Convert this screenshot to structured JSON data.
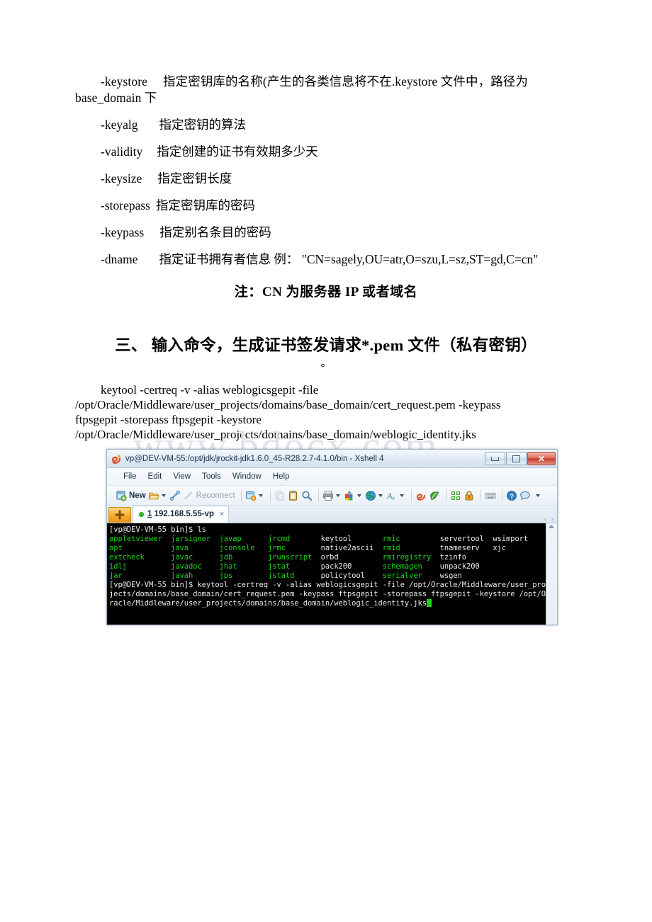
{
  "document": {
    "options": [
      {
        "name": "-keystore",
        "desc": "指定密钥库的名称(产生的各类信息将不在.keystore 文件中，路径为",
        "cont": "base_domain 下"
      },
      {
        "name": "-keyalg",
        "desc": "指定密钥的算法"
      },
      {
        "name": "-validity",
        "desc": "指定创建的证书有效期多少天"
      },
      {
        "name": "-keysize",
        "desc": "指定密钥长度"
      },
      {
        "name": "-storepass",
        "desc": "指定密钥库的密码"
      },
      {
        "name": "-keypass",
        "desc": "指定别名条目的密码"
      },
      {
        "name": "-dname",
        "desc": "指定证书拥有者信息 例：  \"CN=sagely,OU=atr,O=szu,L=sz,ST=gd,C=cn\""
      }
    ],
    "note": "注：CN 为服务器 IP 或者域名",
    "heading": "三、 输入命令，生成证书签发请求*.pem 文件（私有密钥）",
    "heading_tail": "。",
    "command_lines": [
      "keytool -certreq -v -alias weblogicsgepit -file",
      "/opt/Oracle/Middleware/user_projects/domains/base_domain/cert_request.pem -keypass",
      "ftpsgepit -storepass ftpsgepit -keystore",
      "/opt/Oracle/Middleware/user_projects/domains/base_domain/weblogic_identity.jks"
    ],
    "watermark": "www.bdocx.com"
  },
  "xshell": {
    "title": "vp@DEV-VM-55:/opt/jdk/jrockit-jdk1.6.0_45-R28.2.7-4.1.0/bin - Xshell 4",
    "window_buttons": {
      "minimize": "–",
      "maximize": "□",
      "close": "✕"
    },
    "menu": [
      "File",
      "Edit",
      "View",
      "Tools",
      "Window",
      "Help"
    ],
    "toolbar": {
      "new_label": "New",
      "reconnect_label": "Reconnect",
      "icons": [
        "new-session-icon",
        "open-folder-icon",
        "connect-icon",
        "reconnect-icon",
        "session-manager-icon",
        "copy-icon",
        "paste-icon",
        "find-icon",
        "print-icon",
        "color-scheme-icon",
        "globe-icon",
        "font-icon",
        "xshell-icon",
        "xftp-icon",
        "compose-bar-icon",
        "lock-icon",
        "keyboard-icon",
        "help-icon",
        "chat-icon"
      ]
    },
    "tabs": {
      "new_tab_label": "+",
      "active": {
        "number": "1",
        "name": "192.168.5.55-vp",
        "close": "×"
      },
      "nav_prev": "‹",
      "nav_next": "›"
    },
    "terminal": {
      "prompt": "[vp@DEV-VM-55 bin]$ ",
      "first_command": "ls",
      "ls_columns": [
        [
          "appletviewer",
          "apt",
          "extcheck",
          "idlj",
          "jar"
        ],
        [
          "jarsigner",
          "java",
          "javac",
          "javadoc",
          "javah"
        ],
        [
          "javap",
          "jconsole",
          "jdb",
          "jhat",
          "jps"
        ],
        [
          "jrcmd",
          "jrmc",
          "jrunscript",
          "jstat",
          "jstatd"
        ],
        [
          "keytool",
          "native2ascii",
          "orbd",
          "pack200",
          "policytool"
        ],
        [
          "rmic",
          "rmid",
          "rmiregistry",
          "schemagen",
          "serialver"
        ],
        [
          "servertool",
          "tnameserv",
          "tzinfo",
          "unpack200",
          "wsgen"
        ],
        [
          "wsimport",
          "xjc",
          "",
          "",
          ""
        ]
      ],
      "second_command_wrapped": [
        "keytool -certreq -v -alias weblogicsgepit -file /opt/Oracle/Middleware/user_pro",
        "jects/domains/base_domain/cert_request.pem -keypass ftpsgepit -storepass ftpsgepit -keystore /opt/O",
        "racle/Middleware/user_projects/domains/base_domain/weblogic_identity.jks"
      ]
    },
    "scrollbar": {
      "up_arrow": "▲"
    }
  },
  "colors": {
    "terminal_bg": "#000000",
    "terminal_green": "#18d418",
    "terminal_white": "#e9e9e9",
    "titlebar_text": "#19334d",
    "close_button": "#c23d2e",
    "tab_dot_green": "#2fbf2f",
    "watermark": "#e2e0ea"
  }
}
